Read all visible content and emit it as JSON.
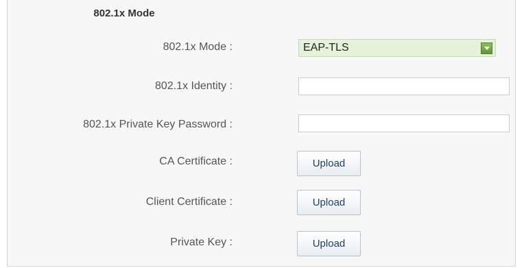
{
  "section": {
    "title": "802.1x Mode"
  },
  "fields": {
    "mode": {
      "label": "802.1x Mode :",
      "value": "EAP-TLS"
    },
    "identity": {
      "label": "802.1x Identity :",
      "value": ""
    },
    "private_key_password": {
      "label": "802.1x Private Key Password :",
      "value": ""
    },
    "ca_certificate": {
      "label": "CA Certificate :",
      "button": "Upload"
    },
    "client_certificate": {
      "label": "Client Certificate :",
      "button": "Upload"
    },
    "private_key": {
      "label": "Private Key :",
      "button": "Upload"
    }
  },
  "colors": {
    "select_bg": "#e6f2da",
    "select_arrow": "#6aa53c",
    "panel_border": "#cbd9df"
  },
  "icons": {
    "dropdown": "chevron-down-icon"
  }
}
